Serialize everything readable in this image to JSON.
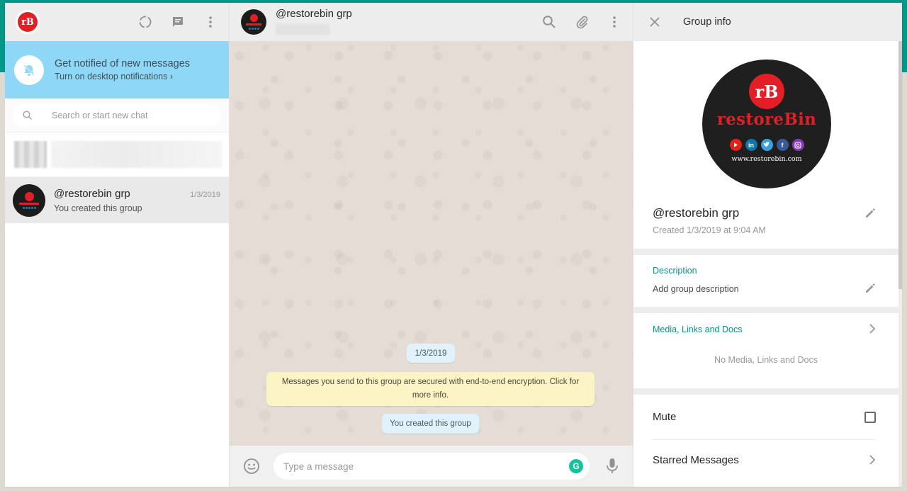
{
  "sidebar": {
    "logo_text": "rB",
    "notification": {
      "title": "Get notified of new messages",
      "subtitle": "Turn on desktop notifications ›"
    },
    "search": {
      "placeholder": "Search or start new chat"
    },
    "chats": [
      {
        "name": "@restorebin grp",
        "time": "1/3/2019",
        "last_message": "You created this group"
      }
    ]
  },
  "conversation": {
    "title": "@restorebin grp",
    "date_label": "1/3/2019",
    "encryption_notice": "Messages you send to this group are secured with end-to-end encryption. Click for more info.",
    "system_message": "You created this group",
    "composer": {
      "placeholder": "Type a message",
      "grammarly_label": "G"
    }
  },
  "group_info": {
    "header_title": "Group info",
    "avatar": {
      "logo_text": "rB",
      "brand": "restoreBin",
      "url": "www.restorebin.com",
      "social_icons": [
        "youtube-icon",
        "linkedin-icon",
        "twitter-icon",
        "facebook-icon",
        "instagram-icon"
      ]
    },
    "name": "@restorebin grp",
    "created": "Created 1/3/2019 at 9:04 AM",
    "description": {
      "label": "Description",
      "value": "Add group description"
    },
    "media": {
      "label": "Media, Links and Docs",
      "empty": "No Media, Links and Docs"
    },
    "mute_label": "Mute",
    "mute_checked": false,
    "starred_label": "Starred Messages"
  },
  "colors": {
    "header_band": "#009688",
    "accent_teal": "#009688",
    "notification_banner": "#8ed7f7",
    "brand_red": "#e21f26",
    "encryption_bubble": "#fcf4c4",
    "system_bubble": "#e1f2fb"
  }
}
